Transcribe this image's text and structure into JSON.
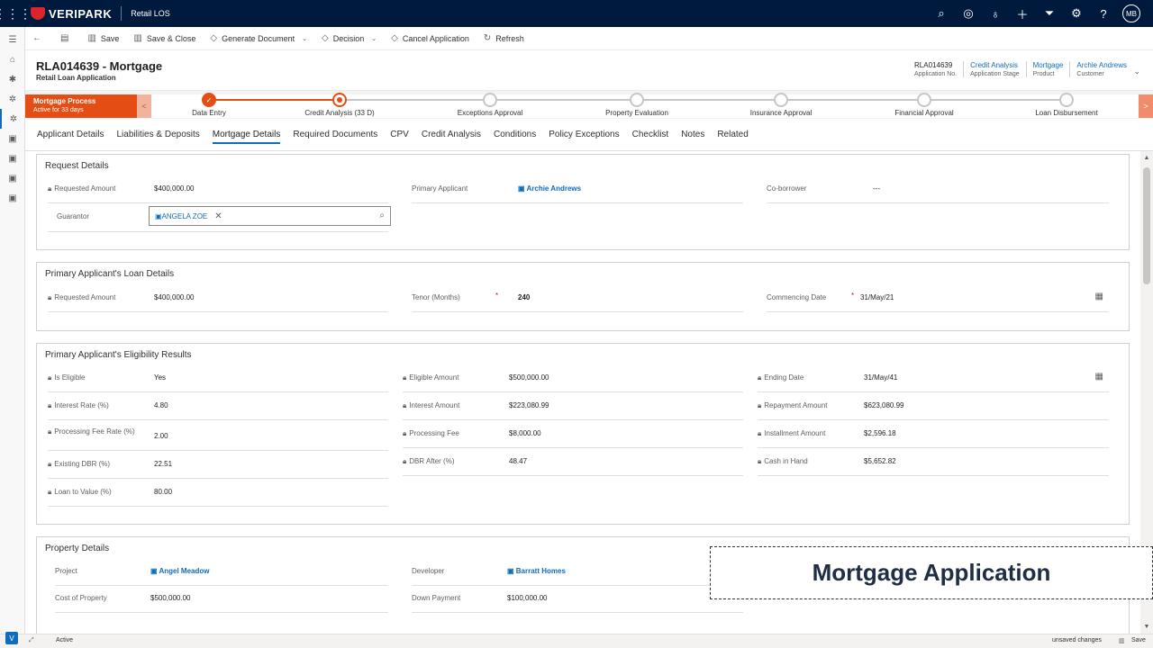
{
  "topbar": {
    "brand": "VERIPARK",
    "app_name": "Retail LOS",
    "avatar_initials": "MB",
    "icons": [
      "search-icon",
      "task-icon",
      "lightbulb-icon",
      "plus-icon",
      "filter-icon",
      "gear-icon",
      "help-icon"
    ]
  },
  "commands": {
    "save": "Save",
    "save_close": "Save & Close",
    "generate_document": "Generate Document",
    "decision": "Decision",
    "cancel_application": "Cancel Application",
    "refresh": "Refresh"
  },
  "header": {
    "title": "RLA014639  -  Mortgage",
    "subtitle": "Retail Loan Application",
    "fields": [
      {
        "value": "RLA014639",
        "label": "Application No.",
        "link": false
      },
      {
        "value": "Credit Analysis",
        "label": "Application Stage",
        "link": true
      },
      {
        "value": "Mortgage",
        "label": "Product",
        "link": true
      },
      {
        "value": "Archie Andrews",
        "label": "Customer",
        "link": true
      }
    ]
  },
  "process": {
    "name": "Mortgage Process",
    "active": "Active for 33 days",
    "stages": [
      "Data Entry",
      "Credit Analysis  (33 D)",
      "Exceptions Approval",
      "Property Evaluation",
      "Insurance Approval",
      "Financial Approval",
      "Loan Disbursement"
    ]
  },
  "tabs": [
    "Applicant Details",
    "Liabilities & Deposits",
    "Mortgage Details",
    "Required Documents",
    "CPV",
    "Credit Analysis",
    "Conditions",
    "Policy Exceptions",
    "Checklist",
    "Notes",
    "Related"
  ],
  "request_details": {
    "title": "Request Details",
    "requested_amount_label": "Requested Amount",
    "requested_amount": "$400,000.00",
    "primary_applicant_label": "Primary Applicant",
    "primary_applicant": "Archie Andrews",
    "coborrower_label": "Co-borrower",
    "coborrower": "---",
    "guarantor_label": "Guarantor",
    "guarantor": "ANGELA ZOE"
  },
  "loan_details": {
    "title": "Primary Applicant's Loan Details",
    "requested_amount_label": "Requested Amount",
    "requested_amount": "$400,000.00",
    "tenor_label": "Tenor (Months)",
    "tenor": "240",
    "commencing_label": "Commencing Date",
    "commencing": "31/May/21",
    "required_mark": "*"
  },
  "eligibility": {
    "title": "Primary Applicant's Eligibility Results",
    "is_eligible_label": "Is Eligible",
    "is_eligible": "Yes",
    "eligible_amount_label": "Eligible Amount",
    "eligible_amount": "$500,000.00",
    "ending_date_label": "Ending Date",
    "ending_date": "31/May/41",
    "interest_rate_label": "Interest Rate (%)",
    "interest_rate": "4.80",
    "interest_amount_label": "Interest Amount",
    "interest_amount": "$223,080.99",
    "repayment_amount_label": "Repayment Amount",
    "repayment_amount": "$623,080.99",
    "processing_fee_rate_label": "Processing Fee Rate (%)",
    "processing_fee_rate": "2.00",
    "processing_fee_label": "Processing Fee",
    "processing_fee": "$8,000.00",
    "installment_amount_label": "Installment Amount",
    "installment_amount": "$2,596.18",
    "existing_dbr_label": "Existing DBR (%)",
    "existing_dbr": "22.51",
    "dbr_after_label": "DBR After (%)",
    "dbr_after": "48.47",
    "cash_in_hand_label": "Cash in Hand",
    "cash_in_hand": "$5,652.82",
    "ltv_label": "Loan to Value (%)",
    "ltv": "80.00"
  },
  "property": {
    "title": "Property Details",
    "project_label": "Project",
    "project": "Angel Meadow",
    "developer_label": "Developer",
    "developer": "Barratt Homes",
    "cost_label": "Cost of Property",
    "cost": "$500,000.00",
    "down_payment_label": "Down Payment",
    "down_payment": "$100,000.00"
  },
  "watermark": "Mortgage Application",
  "status": {
    "state": "Active",
    "unsaved": "unsaved changes",
    "save": "Save"
  }
}
